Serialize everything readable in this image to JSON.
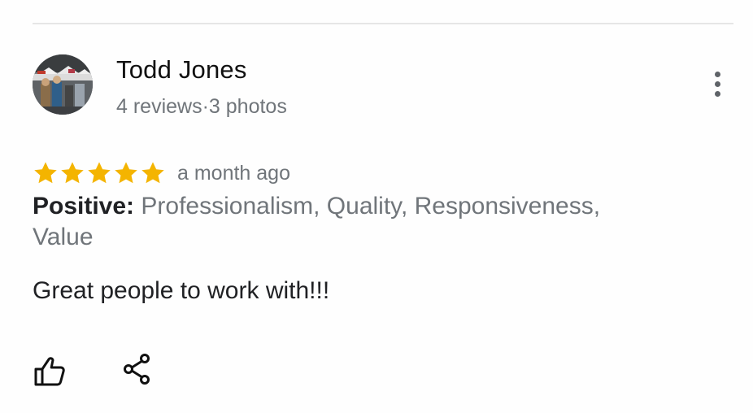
{
  "review": {
    "author": {
      "name": "Todd Jones",
      "meta": "4 reviews·3 photos"
    },
    "rating": 5,
    "date": "a month ago",
    "attributes": {
      "label": "Positive:",
      "values": "Professionalism, Quality, Responsiveness,\n Value"
    },
    "text": "Great people to work with!!!"
  },
  "icons": {
    "avatar": "profile-photo",
    "more": "more-vertical-icon",
    "star": "star-icon",
    "like": "thumbs-up-icon",
    "share": "share-icon"
  },
  "colors": {
    "star": "#f4b400",
    "secondary_text": "#70757a",
    "primary_text": "#202124"
  }
}
